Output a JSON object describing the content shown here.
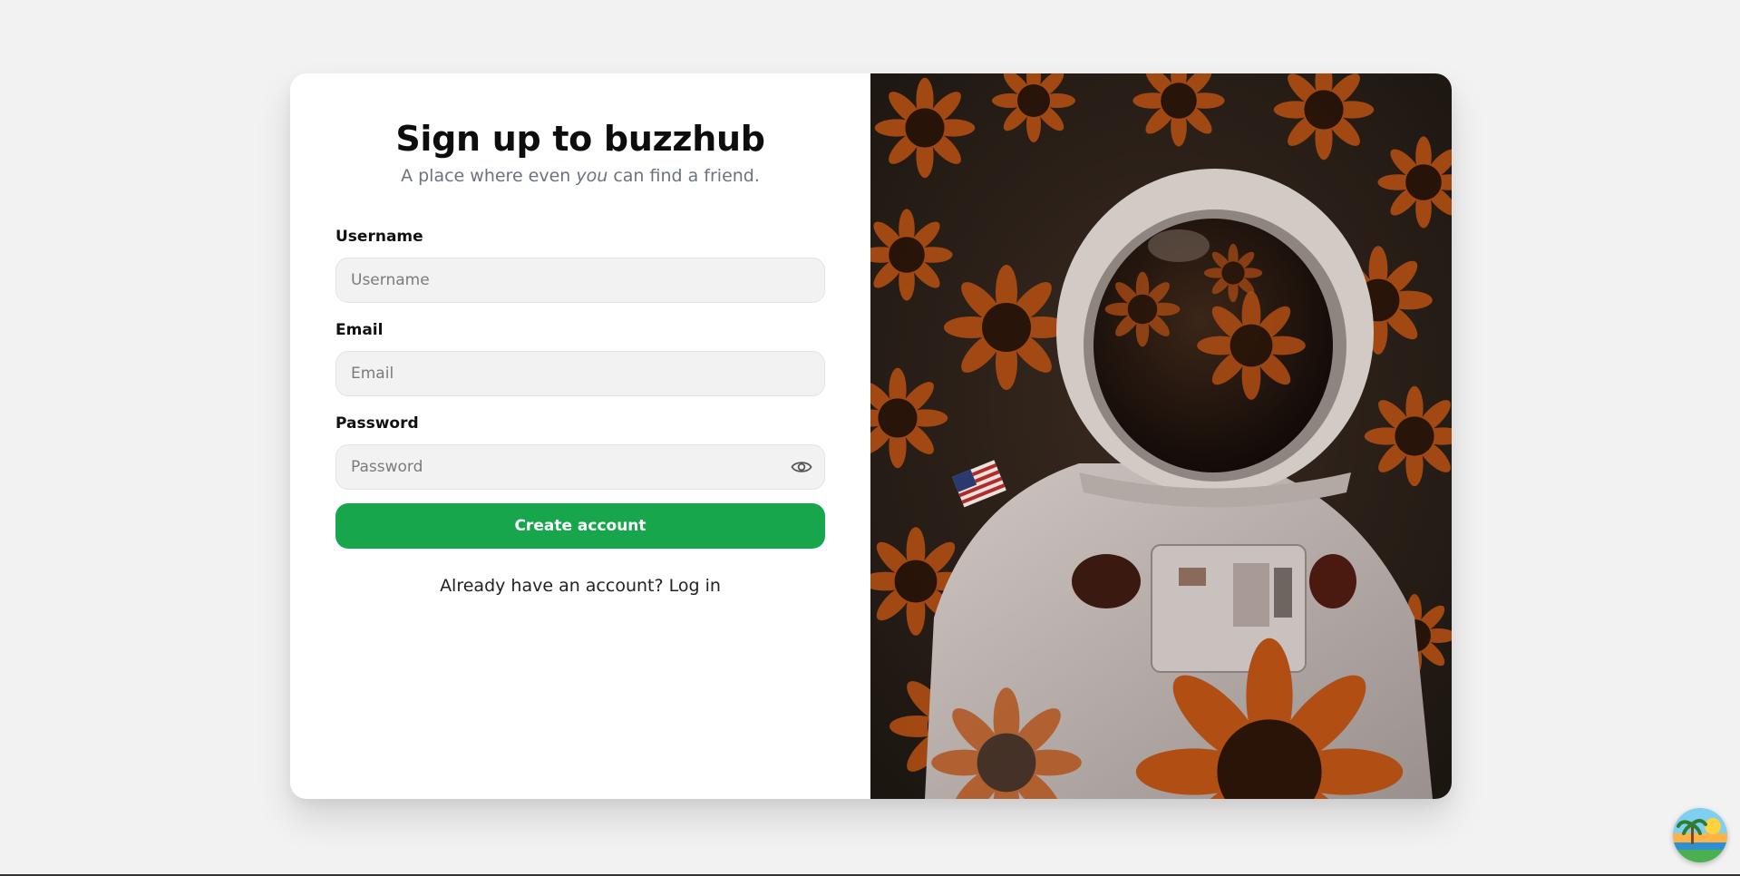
{
  "heading": {
    "title": "Sign up to buzzhub",
    "subtitle_before": "A place where even ",
    "subtitle_emphasis": "you",
    "subtitle_after": " can find a friend."
  },
  "form": {
    "username": {
      "label": "Username",
      "placeholder": "Username",
      "value": ""
    },
    "email": {
      "label": "Email",
      "placeholder": "Email",
      "value": ""
    },
    "password": {
      "label": "Password",
      "placeholder": "Password",
      "value": "",
      "toggle_icon": "eye-icon"
    },
    "submit_label": "Create account"
  },
  "footer": {
    "prompt": "Already have an account? ",
    "link_label": "Log in"
  },
  "hero_image": {
    "subject": "astronaut-in-sunflowers"
  },
  "corner_logo": {
    "icon": "island-sunset-logo-icon"
  },
  "colors": {
    "accent": "#18a64c",
    "background": "#f2f2f2",
    "input_background": "#f2f2f2",
    "subtitle": "#6b7280"
  }
}
